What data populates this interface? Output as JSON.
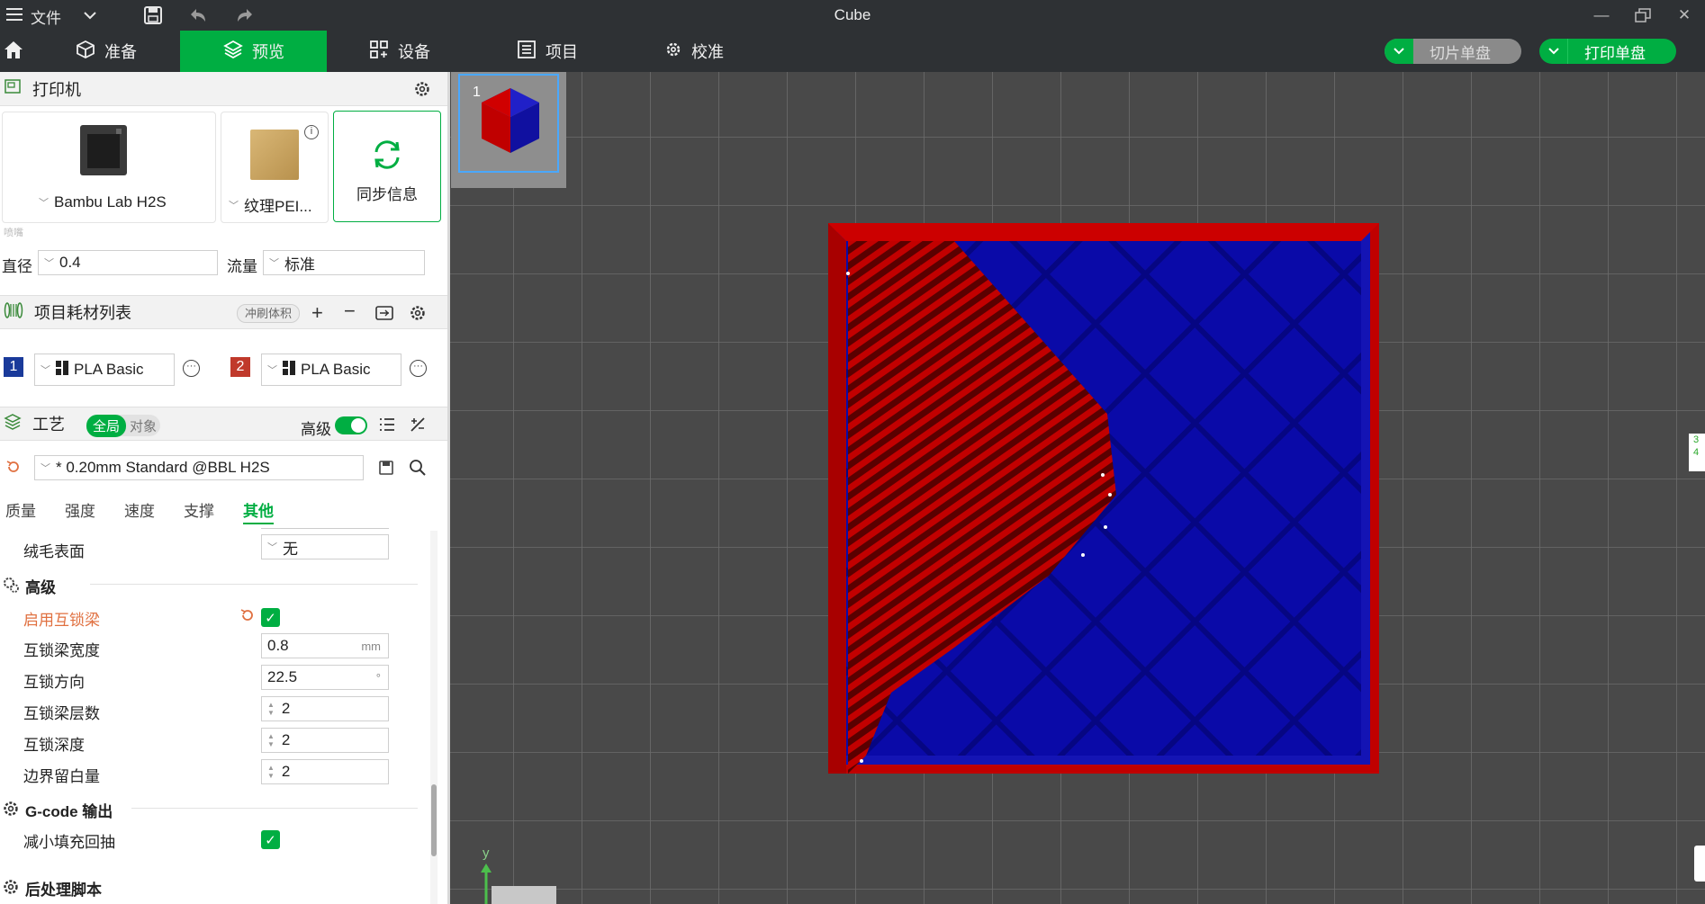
{
  "titlebar": {
    "menu_label": "文件",
    "title": "Cube"
  },
  "tabs": [
    {
      "label": "准备"
    },
    {
      "label": "预览"
    },
    {
      "label": "设备"
    },
    {
      "label": "项目"
    },
    {
      "label": "校准"
    }
  ],
  "actions": {
    "slice_plate": "切片单盘",
    "print_plate": "打印单盘"
  },
  "printer": {
    "section_title": "打印机",
    "printer_name": "Bambu Lab H2S",
    "plate_name": "纹理PEI...",
    "sync_label": "同步信息",
    "nozzle_caption": "喷嘴",
    "diameter_label": "直径",
    "diameter_value": "0.4",
    "flow_label": "流量",
    "flow_value": "标准"
  },
  "filaments": {
    "section_title": "项目耗材列表",
    "flush_badge": "冲刷体积",
    "items": [
      {
        "index": "1",
        "name": "PLA Basic",
        "color": "#1a3a9a"
      },
      {
        "index": "2",
        "name": "PLA Basic",
        "color": "#c0392b"
      }
    ]
  },
  "process": {
    "section_title": "工艺",
    "toggle_global": "全局",
    "toggle_object": "对象",
    "advanced_label": "高级",
    "preset": "* 0.20mm Standard @BBL H2S",
    "subtabs": [
      "质量",
      "强度",
      "速度",
      "支撑",
      "其他"
    ],
    "active_subtab": "其他"
  },
  "settings": {
    "fuzzy_label": "绒毛表面",
    "fuzzy_value": "无",
    "advanced_group": "高级",
    "interlock_enable": "启用互锁梁",
    "interlock_width_label": "互锁梁宽度",
    "interlock_width_value": "0.8",
    "interlock_width_unit": "mm",
    "interlock_dir_label": "互锁方向",
    "interlock_dir_value": "22.5",
    "interlock_dir_unit": "°",
    "interlock_layers_label": "互锁梁层数",
    "interlock_layers_value": "2",
    "interlock_depth_label": "互锁深度",
    "interlock_depth_value": "2",
    "boundary_label": "边界留白量",
    "boundary_value": "2",
    "gcode_group": "G-code 输出",
    "reduce_retract_label": "减小填充回抽",
    "post_script_group": "后处理脚本"
  },
  "viewport": {
    "plate_number": "1",
    "axis_y": "y",
    "side_labels": [
      "3",
      "4"
    ],
    "colors": {
      "red": "#c00000",
      "blue": "#0a0aa8",
      "grid_bg": "#494949",
      "grid_line": "#6e6e6e"
    }
  }
}
